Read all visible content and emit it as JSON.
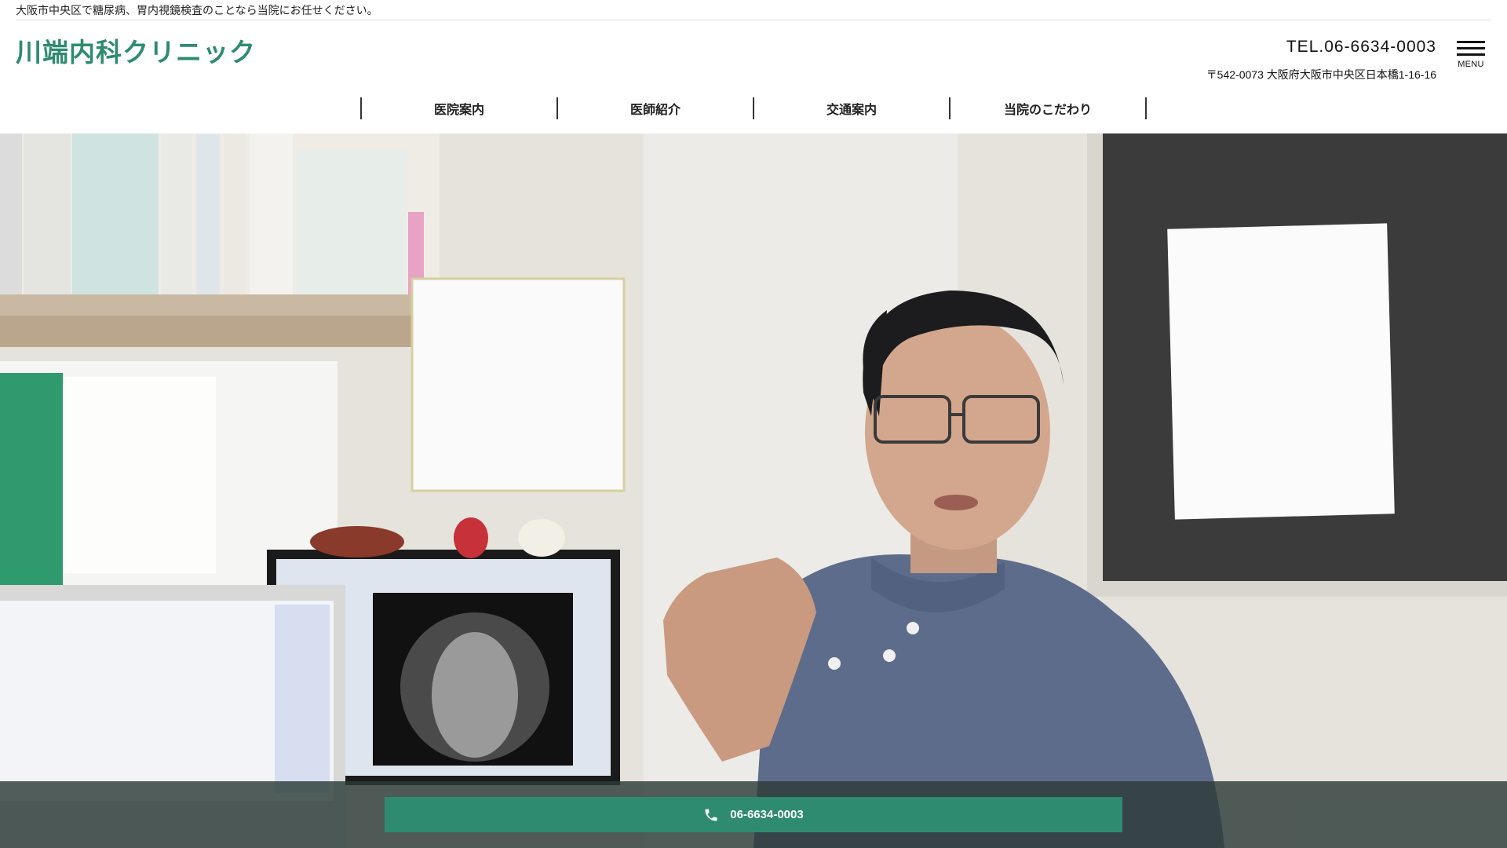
{
  "header": {
    "tagline": "大阪市中央区で糖尿病、胃内視鏡検査のことなら当院にお任せください。",
    "logo": "川端内科クリニック",
    "tel": "TEL.06-6634-0003",
    "address": "〒542-0073 大阪府大阪市中央区日本橋1-16-16",
    "menu_label": "MENU"
  },
  "nav": {
    "items": [
      {
        "label": "医院案内"
      },
      {
        "label": "医師紹介"
      },
      {
        "label": "交通案内"
      },
      {
        "label": "当院のこだわり"
      }
    ]
  },
  "call_bar": {
    "phone": "06-6634-0003",
    "icon": "phone-icon"
  },
  "colors": {
    "brand": "#2e8b6f",
    "call_bar_bg": "#2d3c38"
  }
}
